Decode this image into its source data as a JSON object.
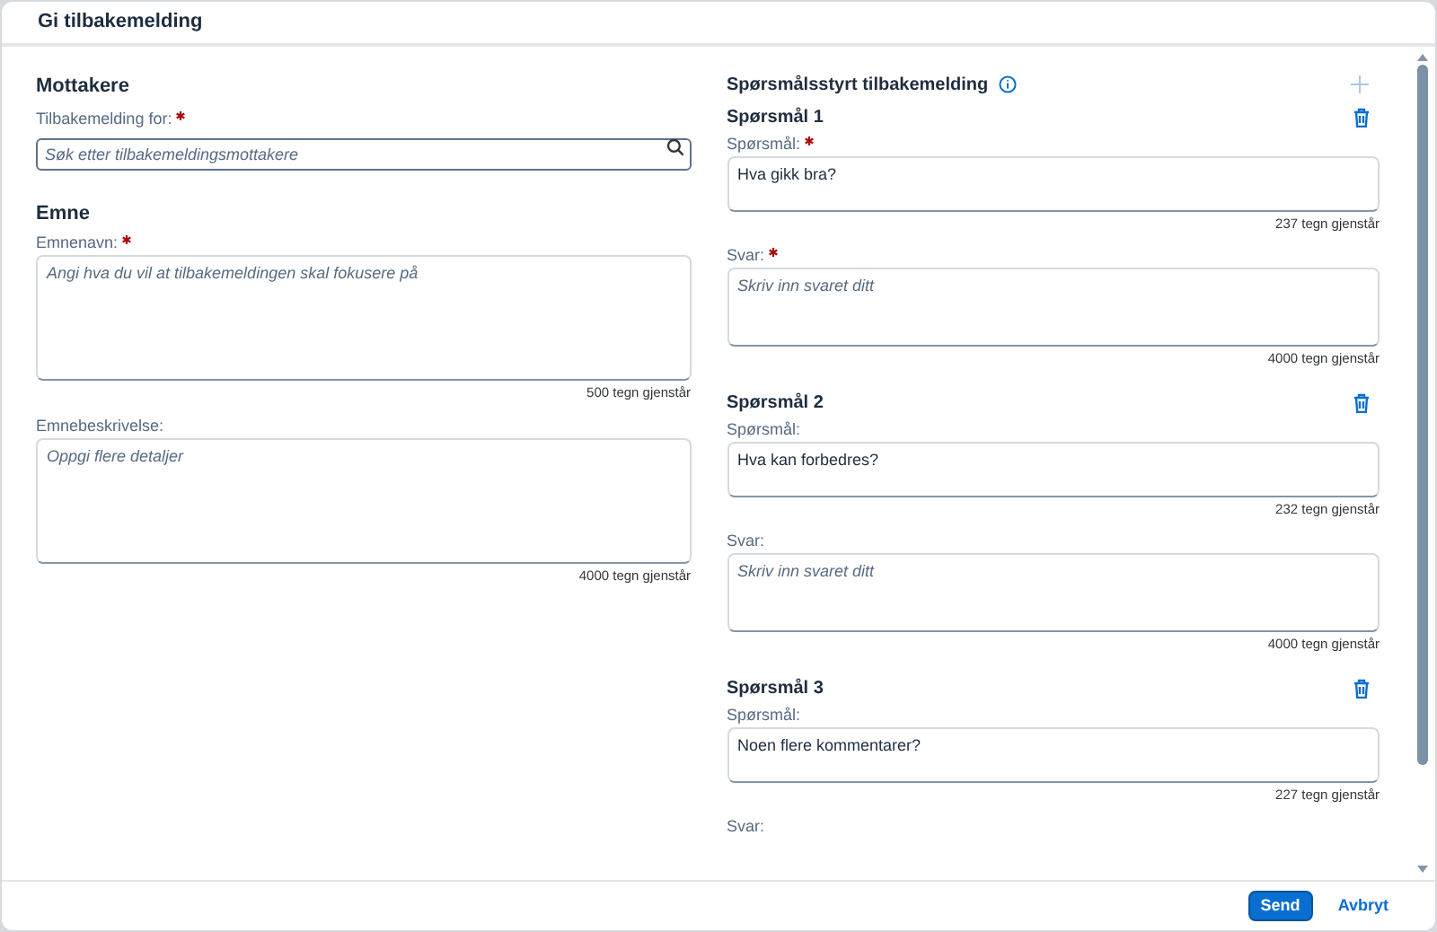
{
  "window": {
    "title": "Gi tilbakemelding"
  },
  "recipients": {
    "heading": "Mottakere",
    "field": {
      "label": "Tilbakemelding for:",
      "required": true,
      "placeholder": "Søk etter tilbakemeldingsmottakere",
      "focused": true
    }
  },
  "topic": {
    "heading": "Emne",
    "fields": [
      {
        "label": "Emnenavn:",
        "required": true,
        "placeholder": "Angi hva du vil at tilbakemeldingen skal fokusere på",
        "counter": "500 tegn gjenstår"
      },
      {
        "label": "Emnebeskrivelse:",
        "required": false,
        "placeholder": "Oppgi flere detaljer",
        "counter": "4000 tegn gjenstår"
      }
    ]
  },
  "questions_section": {
    "heading": "Spørsmålsstyrt tilbakemelding",
    "add_disabled": true,
    "questions": [
      {
        "title": "Spørsmål 1",
        "question": {
          "label": "Spørsmål:",
          "required": true,
          "value": "Hva gikk bra?",
          "counter": "237 tegn gjenstår"
        },
        "answer": {
          "label": "Svar:",
          "required": true,
          "placeholder": "Skriv inn svaret ditt",
          "counter": "4000 tegn gjenstår"
        }
      },
      {
        "title": "Spørsmål 2",
        "question": {
          "label": "Spørsmål:",
          "required": false,
          "value": "Hva kan forbedres?",
          "counter": "232 tegn gjenstår"
        },
        "answer": {
          "label": "Svar:",
          "required": false,
          "placeholder": "Skriv inn svaret ditt",
          "counter": "4000 tegn gjenstår"
        }
      },
      {
        "title": "Spørsmål 3",
        "question": {
          "label": "Spørsmål:",
          "required": false,
          "value": "Noen flere kommentarer?",
          "counter": "227 tegn gjenstår"
        },
        "answer": {
          "label": "Svar:",
          "required": false
        }
      }
    ]
  },
  "buttons": [
    {
      "label": "Send",
      "kind": "primary"
    },
    {
      "label": "Avbryt",
      "kind": "transparent"
    }
  ]
}
